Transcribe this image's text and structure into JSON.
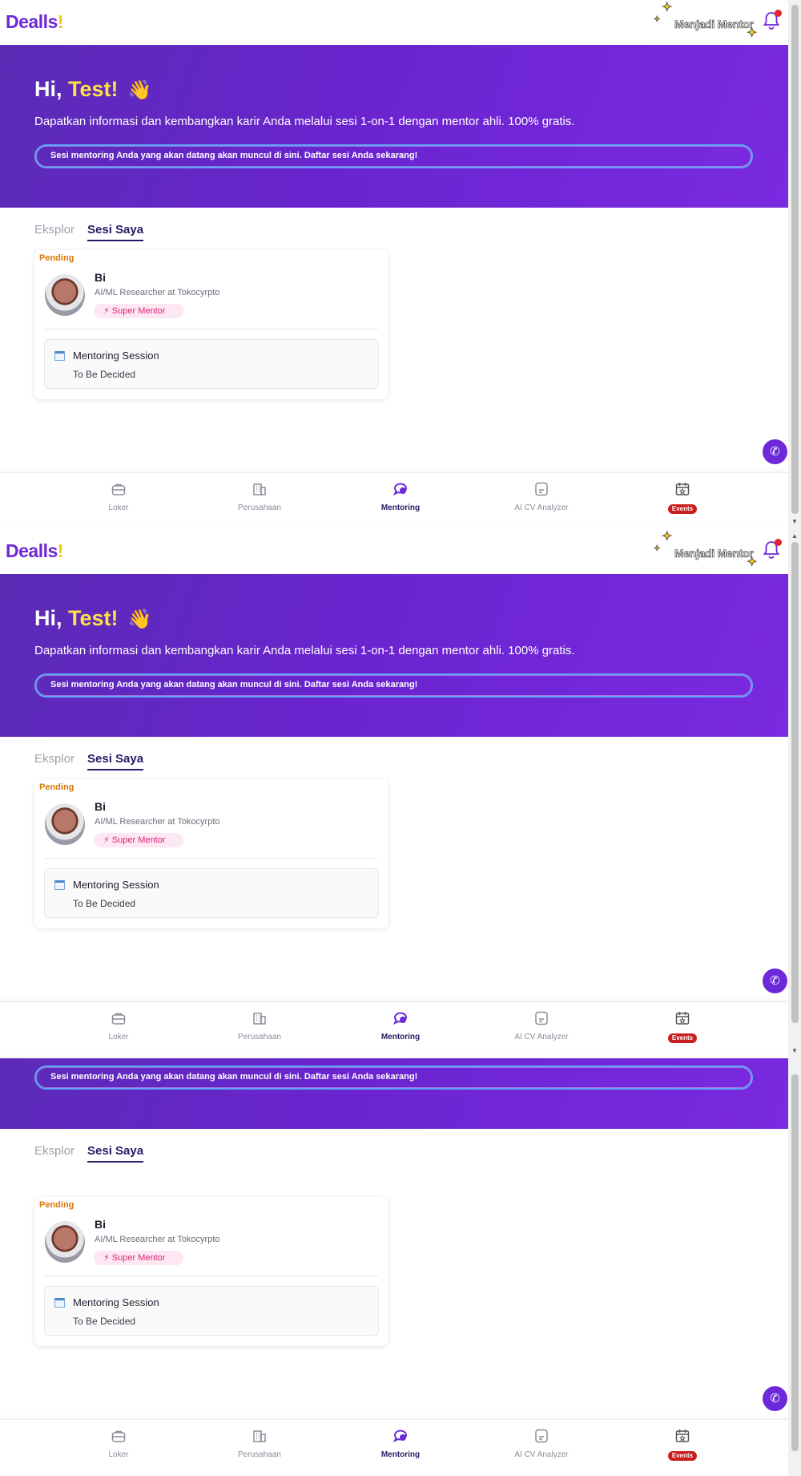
{
  "header": {
    "logo_text": "Dealls",
    "logo_bang": "!",
    "become_mentor": "Menjadi Mentor"
  },
  "hero": {
    "greeting": "Hi,",
    "name": "Test!",
    "wave": "👋",
    "subtitle": "Dapatkan informasi dan kembangkan karir Anda melalui sesi 1-on-1 dengan mentor ahli. 100% gratis.",
    "banner": "Sesi mentoring Anda yang akan datang akan muncul di sini. Daftar sesi Anda sekarang!"
  },
  "tabs": {
    "explore": "Eksplor",
    "my_sessions": "Sesi Saya"
  },
  "card": {
    "status": "Pending",
    "mentor_name": "Bi",
    "mentor_role": "AI/ML Researcher at Tokocyrpto",
    "badge": "⚡ Super Mentor",
    "session_title": "Mentoring Session",
    "session_date": "To Be Decided"
  },
  "nav": {
    "items": [
      {
        "label": "Loker",
        "icon": "briefcase-icon"
      },
      {
        "label": "Perusahaan",
        "icon": "building-icon"
      },
      {
        "label": "Mentoring",
        "icon": "chat-icon"
      },
      {
        "label": "AI CV Analyzer",
        "icon": "document-icon"
      },
      {
        "label": "Events",
        "icon": "calendar-icon"
      }
    ]
  },
  "colors": {
    "brand": "#6d28d9",
    "accent_yellow": "#fde047",
    "pending": "#d97706",
    "badge_text": "#db2777",
    "events": "#c81e1e"
  }
}
